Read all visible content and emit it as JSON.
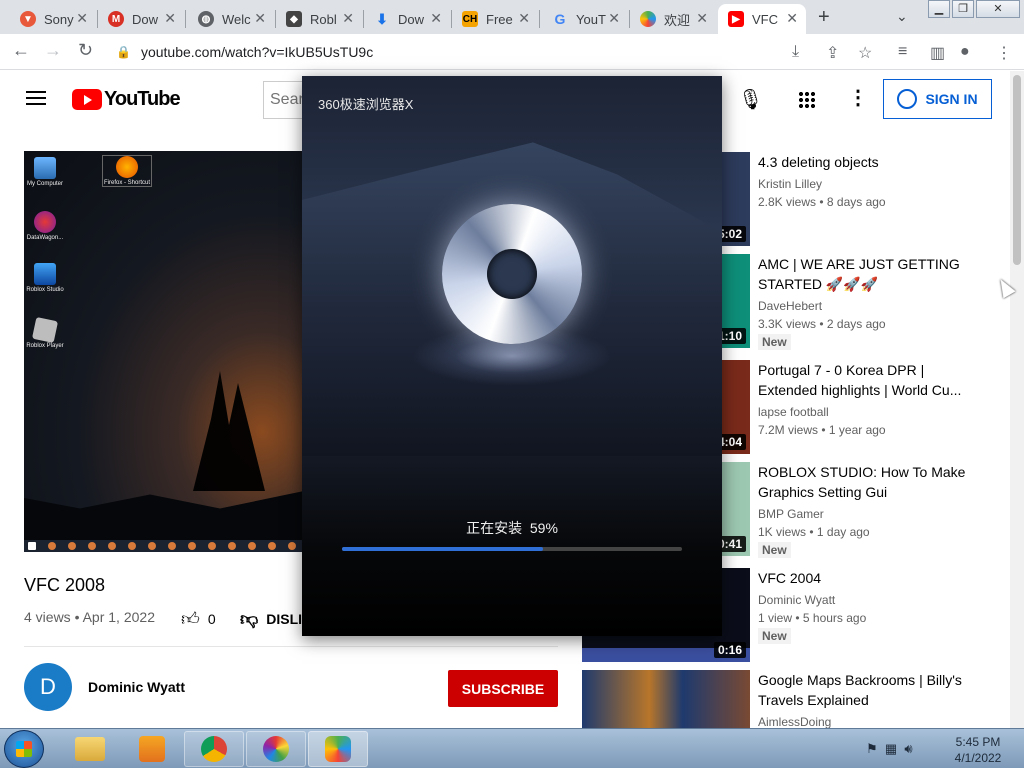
{
  "browser": {
    "tabs": [
      {
        "label": "Sony",
        "icon": "sony-icon",
        "color": "#e8583a"
      },
      {
        "label": "Dow",
        "icon": "gmail-icon",
        "color": "#d93025"
      },
      {
        "label": "Welc",
        "icon": "globe-icon",
        "color": "#5f6368"
      },
      {
        "label": "Robl",
        "icon": "roblox-icon",
        "color": "#444444"
      },
      {
        "label": "Dow",
        "icon": "download-icon",
        "color": "#1a73e8"
      },
      {
        "label": "Free",
        "icon": "ch-icon",
        "color": "#f4a300"
      },
      {
        "label": "YouT",
        "icon": "google-icon",
        "color": "#4285f4"
      },
      {
        "label": "欢迎",
        "icon": "browser-360-icon",
        "color": "#4caf50"
      },
      {
        "label": "VFC",
        "icon": "youtube-icon",
        "color": "#ff0000"
      }
    ],
    "new_tab": "+",
    "url": "youtube.com/watch?v=IkUB5UsTU9c"
  },
  "youtube": {
    "logo_text": "YouTube",
    "search_placeholder": "Sear",
    "sign_in_label": "SIGN IN"
  },
  "video": {
    "title": "VFC 2008",
    "meta": "4 views • Apr 1, 2022",
    "likes": "0",
    "dislike_label": "DISLI",
    "channel_initial": "D",
    "channel_name": "Dominic Wyatt",
    "subscribe_label": "SUBSCRIBE",
    "desktop_icons": [
      "My Computer",
      "Firefox - Shortcut",
      "DataWagon...",
      "Roblox Studio",
      "Roblox Player"
    ]
  },
  "recommendations": [
    {
      "title": "4.3 deleting objects",
      "channel": "Kristin Lilley",
      "meta": "2.8K views • 8 days ago",
      "duration": "5:02",
      "badge": ""
    },
    {
      "title": "AMC | WE ARE JUST GETTING STARTED 🚀🚀🚀",
      "channel": "DaveHebert",
      "meta": "3.3K views • 2 days ago",
      "duration": "1:10",
      "badge": "New"
    },
    {
      "title": "Portugal 7 - 0 Korea DPR | Extended highlights | World Cu...",
      "channel": "lapse football",
      "meta": "7.2M views • 1 year ago",
      "duration": "4:04",
      "badge": ""
    },
    {
      "title": "ROBLOX STUDIO: How To Make Graphics Setting Gui",
      "channel": "BMP Gamer",
      "meta": "1K views • 1 day ago",
      "duration": "0:41",
      "badge": "New"
    },
    {
      "title": "VFC 2004",
      "channel": "Dominic Wyatt",
      "meta": "1 view • 5 hours ago",
      "duration": "0:16",
      "badge": "New"
    },
    {
      "title": "Google Maps Backrooms | Billy's Travels Explained",
      "channel": "AimlessDoing",
      "meta": "",
      "duration": "",
      "badge": ""
    }
  ],
  "installer": {
    "title": "360极速浏览器X",
    "status_text": "正在安装",
    "progress_label": "59%",
    "progress": 0.59
  },
  "taskbar": {
    "time": "5:45 PM",
    "date": "4/1/2022"
  }
}
